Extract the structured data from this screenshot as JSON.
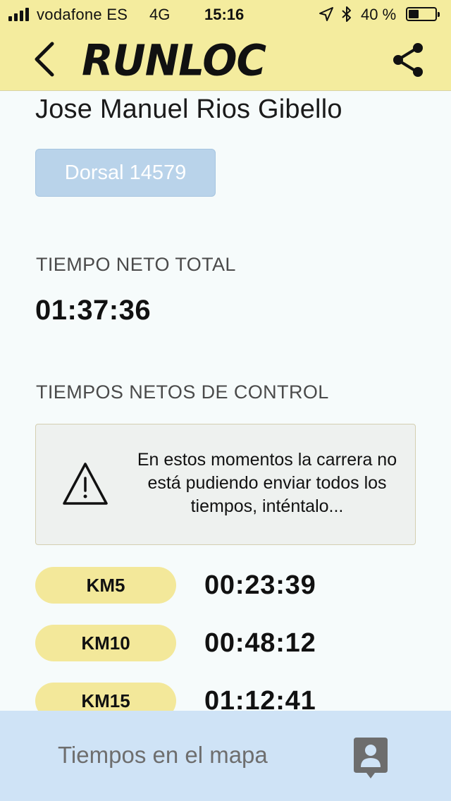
{
  "status_bar": {
    "carrier": "vodafone ES",
    "network": "4G",
    "time": "15:16",
    "battery": "40 %",
    "battery_level": 0.4
  },
  "header": {
    "brand": "RUNLOC",
    "back_icon": "chevron-left-icon",
    "share_icon": "share-icon"
  },
  "runner": {
    "name": "Jose Manuel Rios Gibello",
    "bib": "Dorsal 14579"
  },
  "total": {
    "label": "TIEMPO NETO TOTAL",
    "time": "01:37:36"
  },
  "control": {
    "label": "TIEMPOS NETOS DE CONTROL",
    "warning": "En estos momentos la carrera no está pudiendo enviar todos los tiempos, inténtalo...",
    "warning_icon": "warning-triangle-icon",
    "splits": [
      {
        "km": "KM5",
        "time": "00:23:39"
      },
      {
        "km": "KM10",
        "time": "00:48:12"
      },
      {
        "km": "KM15",
        "time": "01:12:41"
      }
    ]
  },
  "bottom": {
    "map_label": "Tiempos en el mapa",
    "map_icon": "map-pin-person-icon"
  },
  "colors": {
    "header_bg": "#f4ec9e",
    "pill_bg": "#f3e89a",
    "bib_bg": "#b9d3ea",
    "bottom_bg": "#cfe3f6",
    "page_bg": "#f6fbfb"
  }
}
